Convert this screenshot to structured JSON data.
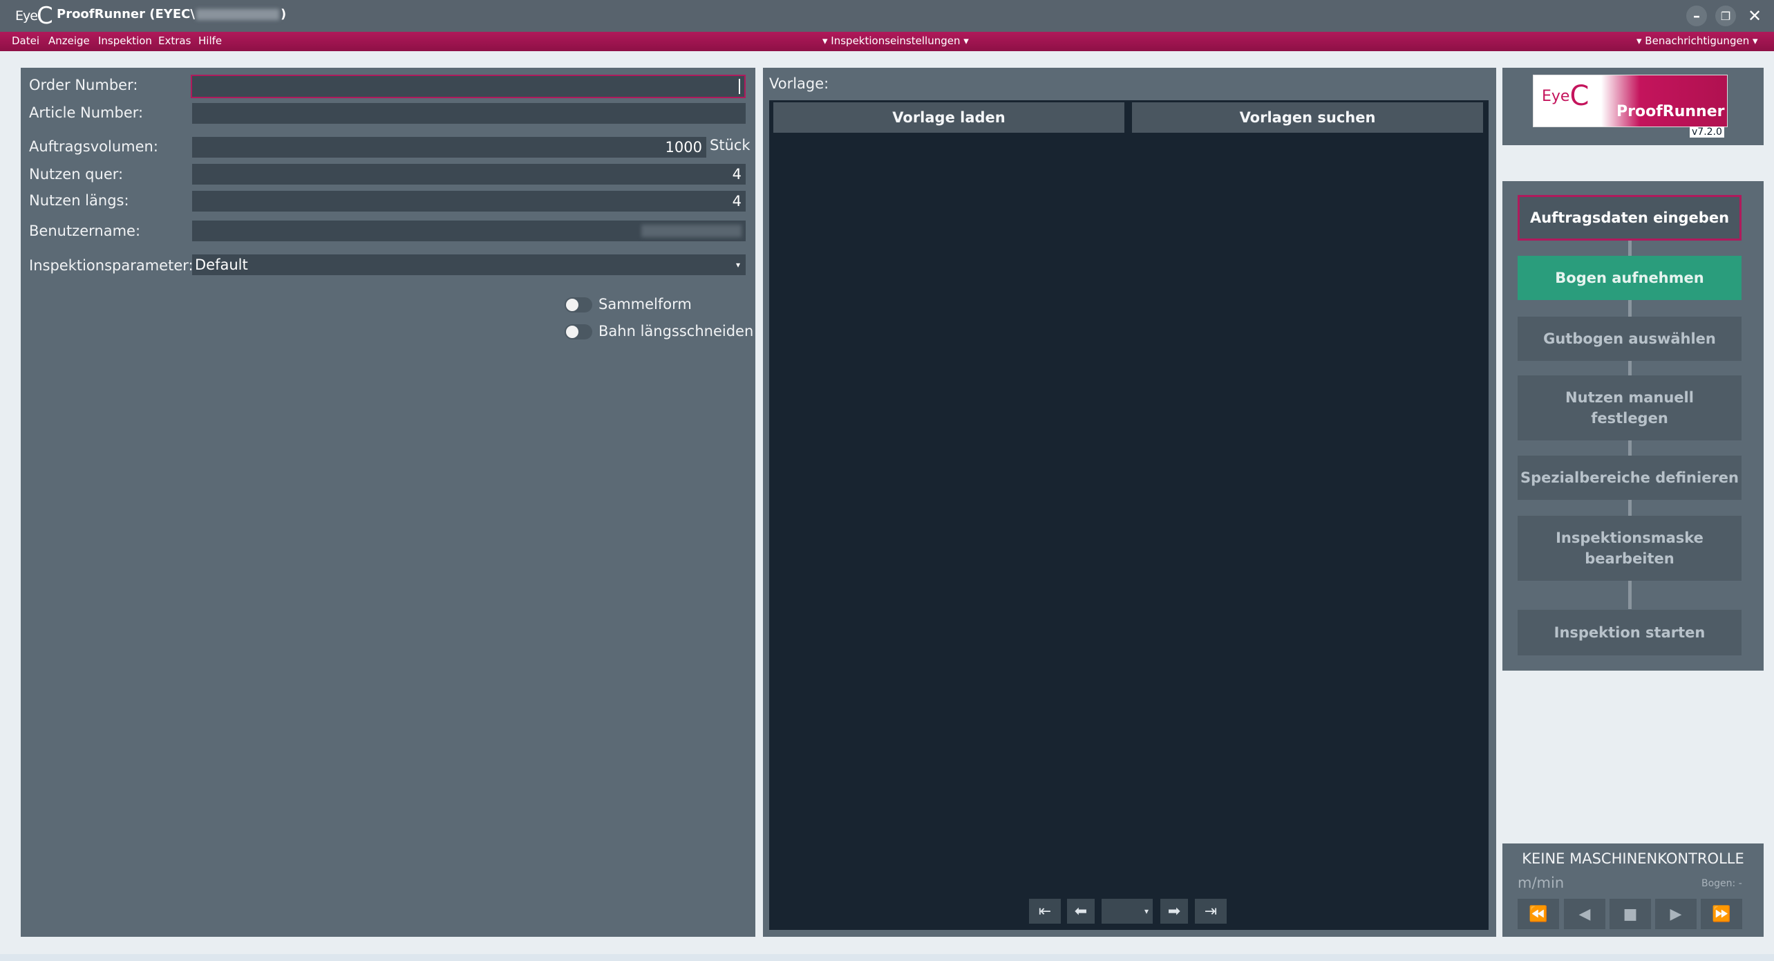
{
  "window": {
    "title_prefix": "ProofRunner  (EYEC\\",
    "title_suffix": ")",
    "logo_eye": "Eye",
    "logo_c": "C",
    "minimize_icon": "minimize-icon",
    "restore_icon": "restore-icon",
    "close_icon": "close-icon"
  },
  "menubar": {
    "items": [
      "Datei",
      "Anzeige",
      "Inspektion",
      "Extras",
      "Hilfe"
    ],
    "center": "▾ Inspektionseinstellungen ▾",
    "right": "▾ Benachrichtigungen ▾"
  },
  "form": {
    "order_number_label": "Order Number:",
    "order_number_value": "",
    "article_number_label": "Article Number:",
    "article_number_value": "",
    "volume_label": "Auftragsvolumen:",
    "volume_value": "1000",
    "volume_unit": "Stück",
    "across_label": "Nutzen quer:",
    "across_value": "4",
    "along_label": "Nutzen längs:",
    "along_value": "4",
    "username_label": "Benutzername:",
    "params_label": "Inspektionsparameter:",
    "params_value": "Default",
    "toggle_sammelform": "Sammelform",
    "toggle_bahn": "Bahn längsschneiden"
  },
  "template": {
    "label": "Vorlage:",
    "load_button": "Vorlage laden",
    "search_button": "Vorlagen suchen"
  },
  "brand": {
    "product": "ProofRunner",
    "version": "v7.2.0",
    "logo_eye": "Eye",
    "logo_c": "C"
  },
  "workflow": {
    "steps": [
      {
        "label": "Auftragsdaten eingeben",
        "state": "current"
      },
      {
        "label": "Bogen aufnehmen",
        "state": "next"
      },
      {
        "label": "Gutbogen auswählen",
        "state": "disabled"
      },
      {
        "label": "Nutzen manuell festlegen",
        "state": "disabled"
      },
      {
        "label": "Spezialbereiche definieren",
        "state": "disabled"
      },
      {
        "label": "Inspektionsmaske bearbeiten",
        "state": "disabled"
      },
      {
        "label": "Inspektion starten",
        "state": "disabled"
      }
    ]
  },
  "machine": {
    "status": "KEINE MASCHINENKONTROLLE",
    "speed_unit": "m/min",
    "sheet_label": "Bogen: -"
  },
  "colors": {
    "accent": "#b01a5c",
    "next_step": "#2a9d7c",
    "panel": "#5c6a75",
    "viewer": "#182430"
  }
}
